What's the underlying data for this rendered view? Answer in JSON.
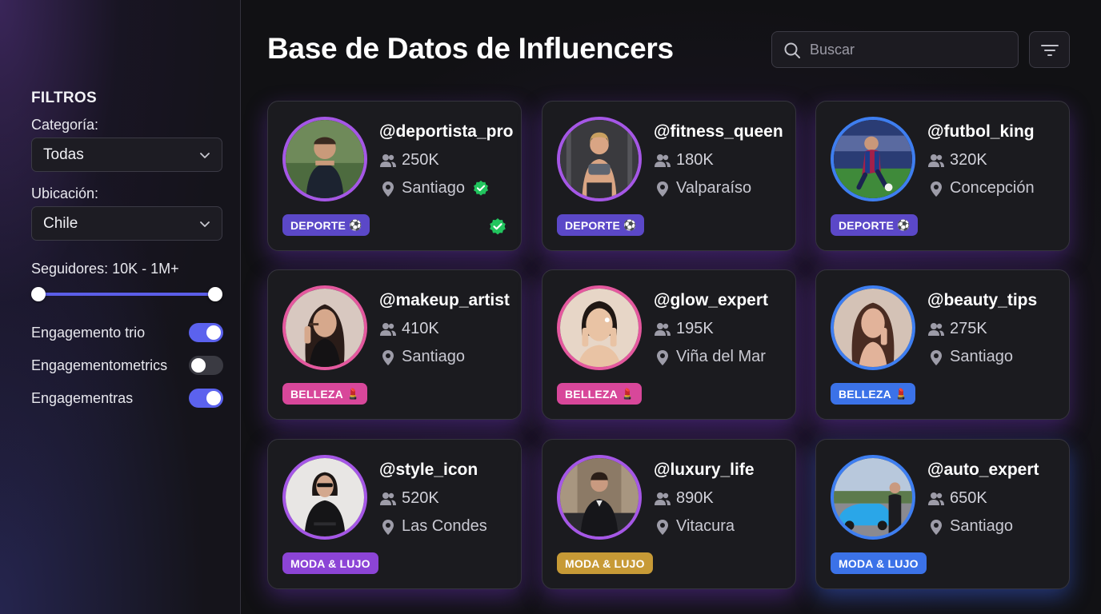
{
  "sidebar": {
    "filters_title": "FILTROS",
    "category_label": "Categoría:",
    "category_value": "Todas",
    "location_label": "Ubicación:",
    "location_value": "Chile",
    "followers_label": "Seguidores: 10K - 1M+",
    "followers_range": {
      "min_fraction": 0.0,
      "max_fraction": 1.0
    },
    "toggles": [
      {
        "label": "Engagemento trio",
        "on": true
      },
      {
        "label": "Engagementometrics",
        "on": false
      },
      {
        "label": "Engagementras",
        "on": true
      }
    ]
  },
  "header": {
    "title": "Base de Datos de Influencers",
    "search_placeholder": "Buscar"
  },
  "colors": {
    "accent": "#5b62ee",
    "verified": "#22c55e",
    "deporte": "#5b48c8",
    "belleza_pink": "#d8479a",
    "belleza_blue": "#3b72e8",
    "moda_purple": "#8c44d6",
    "moda_gold": "#c79a36"
  },
  "cards": [
    {
      "handle": "@deportista_pro",
      "followers": "250K",
      "location": "Santiago",
      "badge": "DEPORTE",
      "badge_emoji": "⚽",
      "verified": true
    },
    {
      "handle": "@fitness_queen",
      "followers": "180K",
      "location": "Valparaíso",
      "badge": "DEPORTE",
      "badge_emoji": "⚽"
    },
    {
      "handle": "@futbol_king",
      "followers": "320K",
      "location": "Concepción",
      "badge": "DEPORTE",
      "badge_emoji": "⚽"
    },
    {
      "handle": "@makeup_artist",
      "followers": "410K",
      "location": "Santiago",
      "badge": "BELLEZA",
      "badge_emoji": "💄"
    },
    {
      "handle": "@glow_expert",
      "followers": "195K",
      "location": "Viña del Mar",
      "badge": "BELLEZA",
      "badge_emoji": "💄"
    },
    {
      "handle": "@beauty_tips",
      "followers": "275K",
      "location": "Santiago",
      "badge": "BELLEZA",
      "badge_emoji": "💄"
    },
    {
      "handle": "@style_icon",
      "followers": "520K",
      "location": "Las Condes",
      "badge": "MODA & LUJO"
    },
    {
      "handle": "@luxury_life",
      "followers": "890K",
      "location": "Vitacura",
      "badge": "MODA & LUJO"
    },
    {
      "handle": "@auto_expert",
      "followers": "650K",
      "location": "Santiago",
      "badge": "MODA & LUJO"
    }
  ]
}
